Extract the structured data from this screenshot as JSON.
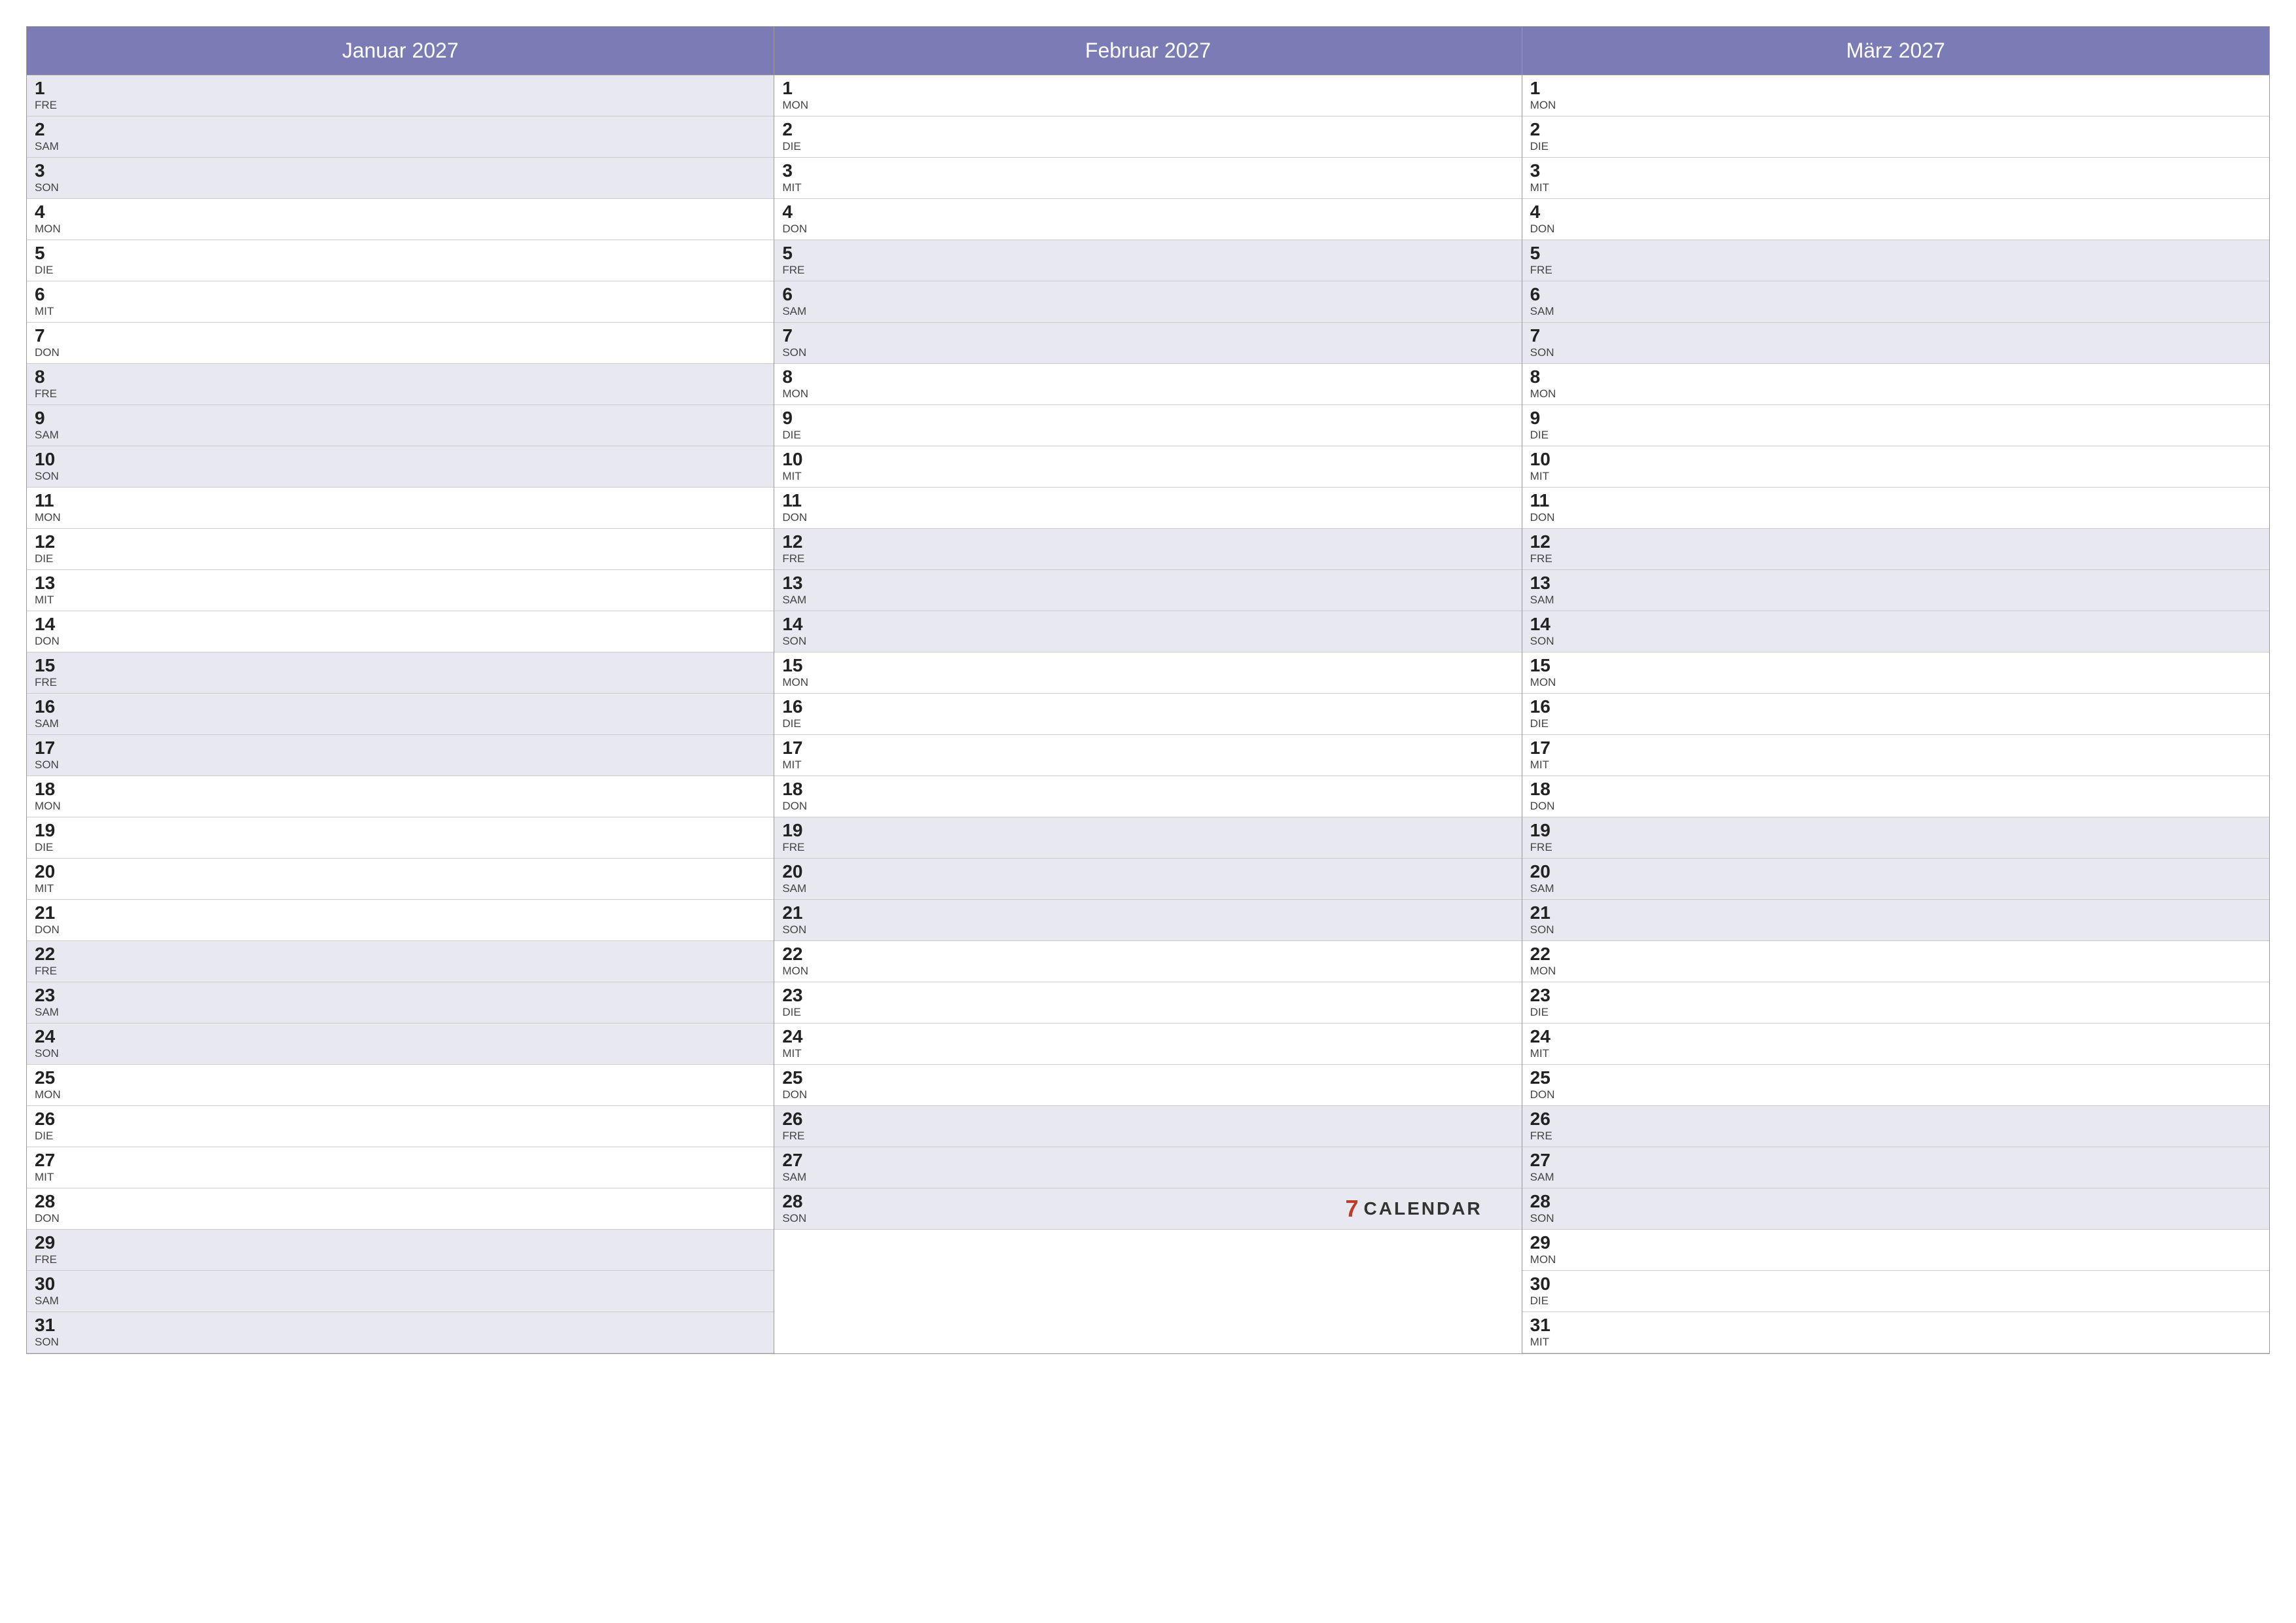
{
  "calendar": {
    "months": [
      {
        "id": "januar",
        "title": "Januar 2027",
        "days": [
          {
            "num": "1",
            "name": "FRE",
            "weekend": true
          },
          {
            "num": "2",
            "name": "SAM",
            "weekend": true
          },
          {
            "num": "3",
            "name": "SON",
            "weekend": true
          },
          {
            "num": "4",
            "name": "MON",
            "weekend": false
          },
          {
            "num": "5",
            "name": "DIE",
            "weekend": false
          },
          {
            "num": "6",
            "name": "MIT",
            "weekend": false
          },
          {
            "num": "7",
            "name": "DON",
            "weekend": false
          },
          {
            "num": "8",
            "name": "FRE",
            "weekend": true
          },
          {
            "num": "9",
            "name": "SAM",
            "weekend": true
          },
          {
            "num": "10",
            "name": "SON",
            "weekend": true
          },
          {
            "num": "11",
            "name": "MON",
            "weekend": false
          },
          {
            "num": "12",
            "name": "DIE",
            "weekend": false
          },
          {
            "num": "13",
            "name": "MIT",
            "weekend": false
          },
          {
            "num": "14",
            "name": "DON",
            "weekend": false
          },
          {
            "num": "15",
            "name": "FRE",
            "weekend": true
          },
          {
            "num": "16",
            "name": "SAM",
            "weekend": true
          },
          {
            "num": "17",
            "name": "SON",
            "weekend": true
          },
          {
            "num": "18",
            "name": "MON",
            "weekend": false
          },
          {
            "num": "19",
            "name": "DIE",
            "weekend": false
          },
          {
            "num": "20",
            "name": "MIT",
            "weekend": false
          },
          {
            "num": "21",
            "name": "DON",
            "weekend": false
          },
          {
            "num": "22",
            "name": "FRE",
            "weekend": true
          },
          {
            "num": "23",
            "name": "SAM",
            "weekend": true
          },
          {
            "num": "24",
            "name": "SON",
            "weekend": true
          },
          {
            "num": "25",
            "name": "MON",
            "weekend": false
          },
          {
            "num": "26",
            "name": "DIE",
            "weekend": false
          },
          {
            "num": "27",
            "name": "MIT",
            "weekend": false
          },
          {
            "num": "28",
            "name": "DON",
            "weekend": false
          },
          {
            "num": "29",
            "name": "FRE",
            "weekend": true
          },
          {
            "num": "30",
            "name": "SAM",
            "weekend": true
          },
          {
            "num": "31",
            "name": "SON",
            "weekend": true
          }
        ]
      },
      {
        "id": "februar",
        "title": "Februar 2027",
        "days": [
          {
            "num": "1",
            "name": "MON",
            "weekend": false
          },
          {
            "num": "2",
            "name": "DIE",
            "weekend": false
          },
          {
            "num": "3",
            "name": "MIT",
            "weekend": false
          },
          {
            "num": "4",
            "name": "DON",
            "weekend": false
          },
          {
            "num": "5",
            "name": "FRE",
            "weekend": true
          },
          {
            "num": "6",
            "name": "SAM",
            "weekend": true
          },
          {
            "num": "7",
            "name": "SON",
            "weekend": true
          },
          {
            "num": "8",
            "name": "MON",
            "weekend": false
          },
          {
            "num": "9",
            "name": "DIE",
            "weekend": false
          },
          {
            "num": "10",
            "name": "MIT",
            "weekend": false
          },
          {
            "num": "11",
            "name": "DON",
            "weekend": false
          },
          {
            "num": "12",
            "name": "FRE",
            "weekend": true
          },
          {
            "num": "13",
            "name": "SAM",
            "weekend": true
          },
          {
            "num": "14",
            "name": "SON",
            "weekend": true
          },
          {
            "num": "15",
            "name": "MON",
            "weekend": false
          },
          {
            "num": "16",
            "name": "DIE",
            "weekend": false
          },
          {
            "num": "17",
            "name": "MIT",
            "weekend": false
          },
          {
            "num": "18",
            "name": "DON",
            "weekend": false
          },
          {
            "num": "19",
            "name": "FRE",
            "weekend": true
          },
          {
            "num": "20",
            "name": "SAM",
            "weekend": true
          },
          {
            "num": "21",
            "name": "SON",
            "weekend": true
          },
          {
            "num": "22",
            "name": "MON",
            "weekend": false
          },
          {
            "num": "23",
            "name": "DIE",
            "weekend": false
          },
          {
            "num": "24",
            "name": "MIT",
            "weekend": false
          },
          {
            "num": "25",
            "name": "DON",
            "weekend": false
          },
          {
            "num": "26",
            "name": "FRE",
            "weekend": true
          },
          {
            "num": "27",
            "name": "SAM",
            "weekend": true
          },
          {
            "num": "28",
            "name": "SON",
            "weekend": true
          }
        ]
      },
      {
        "id": "maerz",
        "title": "März 2027",
        "days": [
          {
            "num": "1",
            "name": "MON",
            "weekend": false
          },
          {
            "num": "2",
            "name": "DIE",
            "weekend": false
          },
          {
            "num": "3",
            "name": "MIT",
            "weekend": false
          },
          {
            "num": "4",
            "name": "DON",
            "weekend": false
          },
          {
            "num": "5",
            "name": "FRE",
            "weekend": true
          },
          {
            "num": "6",
            "name": "SAM",
            "weekend": true
          },
          {
            "num": "7",
            "name": "SON",
            "weekend": true
          },
          {
            "num": "8",
            "name": "MON",
            "weekend": false
          },
          {
            "num": "9",
            "name": "DIE",
            "weekend": false
          },
          {
            "num": "10",
            "name": "MIT",
            "weekend": false
          },
          {
            "num": "11",
            "name": "DON",
            "weekend": false
          },
          {
            "num": "12",
            "name": "FRE",
            "weekend": true
          },
          {
            "num": "13",
            "name": "SAM",
            "weekend": true
          },
          {
            "num": "14",
            "name": "SON",
            "weekend": true
          },
          {
            "num": "15",
            "name": "MON",
            "weekend": false
          },
          {
            "num": "16",
            "name": "DIE",
            "weekend": false
          },
          {
            "num": "17",
            "name": "MIT",
            "weekend": false
          },
          {
            "num": "18",
            "name": "DON",
            "weekend": false
          },
          {
            "num": "19",
            "name": "FRE",
            "weekend": true
          },
          {
            "num": "20",
            "name": "SAM",
            "weekend": true
          },
          {
            "num": "21",
            "name": "SON",
            "weekend": true
          },
          {
            "num": "22",
            "name": "MON",
            "weekend": false
          },
          {
            "num": "23",
            "name": "DIE",
            "weekend": false
          },
          {
            "num": "24",
            "name": "MIT",
            "weekend": false
          },
          {
            "num": "25",
            "name": "DON",
            "weekend": false
          },
          {
            "num": "26",
            "name": "FRE",
            "weekend": true
          },
          {
            "num": "27",
            "name": "SAM",
            "weekend": true
          },
          {
            "num": "28",
            "name": "SON",
            "weekend": true
          },
          {
            "num": "29",
            "name": "MON",
            "weekend": false
          },
          {
            "num": "30",
            "name": "DIE",
            "weekend": false
          },
          {
            "num": "31",
            "name": "MIT",
            "weekend": false
          }
        ]
      }
    ],
    "logo": {
      "icon": "7",
      "text": "CALENDAR"
    }
  }
}
